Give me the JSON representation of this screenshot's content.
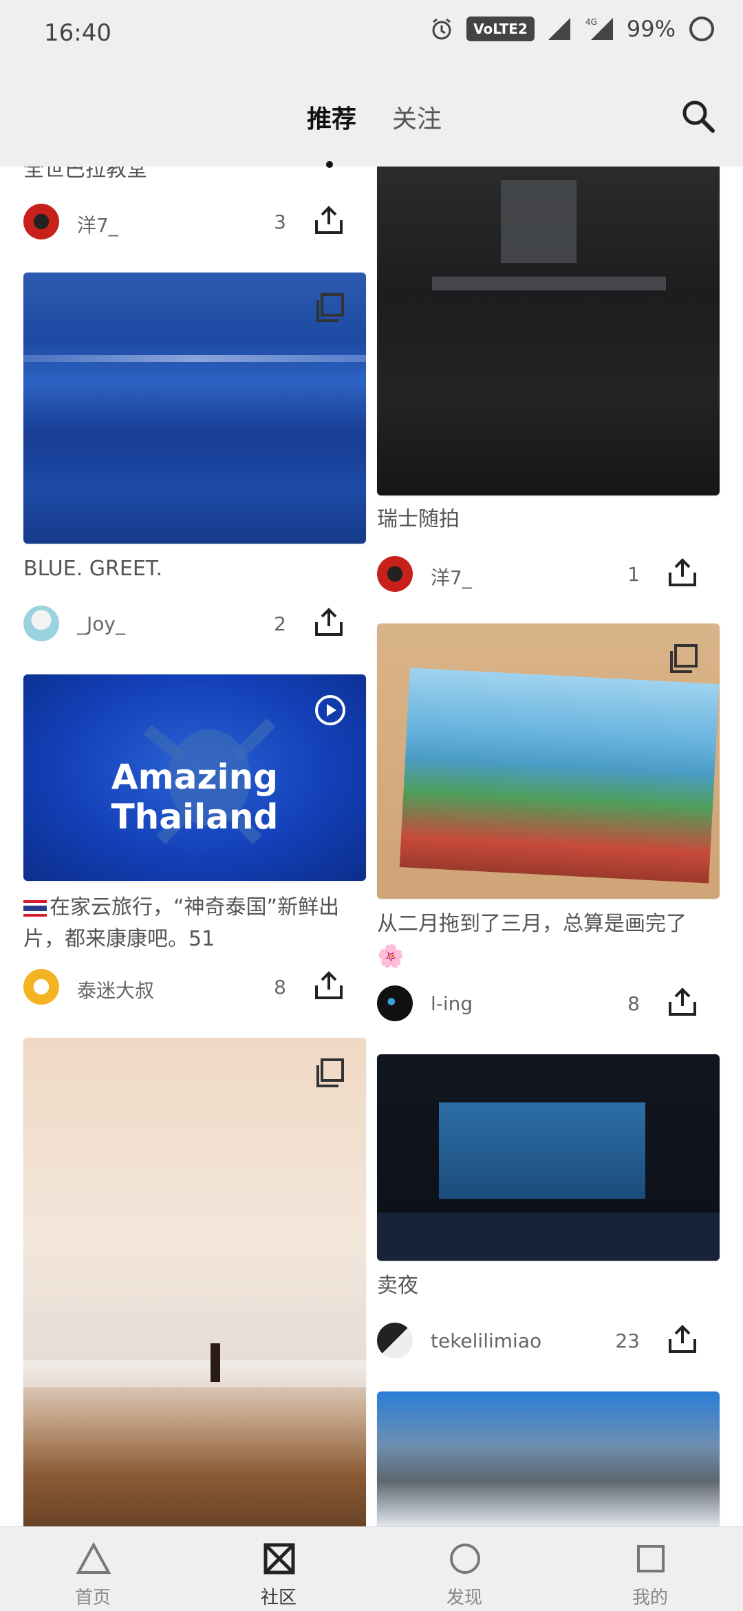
{
  "status": {
    "time": "16:40",
    "network": "VoLTE2",
    "network_type": "4G",
    "battery": "99%"
  },
  "tabs": {
    "recommended": "推荐",
    "following": "关注"
  },
  "cards": {
    "l0": {
      "title": "全世巴拉教堂",
      "user": "洋7_",
      "count": "3"
    },
    "l1": {
      "title": "BLUE. GREET.",
      "user": "_Joy_",
      "count": "2"
    },
    "l2": {
      "title": "在家云旅行，“神奇泰国”新鲜出片，都来康康吧。51",
      "overlay_text": "Amazing Thailand",
      "user": "泰迷大叔",
      "count": "8"
    },
    "r0": {
      "title": "瑞士随拍",
      "user": "洋7_",
      "count": "1"
    },
    "r1": {
      "title": "从二月拖到了三月，总算是画完了",
      "emoji": "🌸",
      "user": "l-ing",
      "count": "8"
    },
    "r2": {
      "title": "卖夜",
      "user": "tekelilimiao",
      "count": "23"
    }
  },
  "bottom_nav": {
    "home": "首页",
    "community": "社区",
    "discover": "发现",
    "mine": "我的"
  }
}
